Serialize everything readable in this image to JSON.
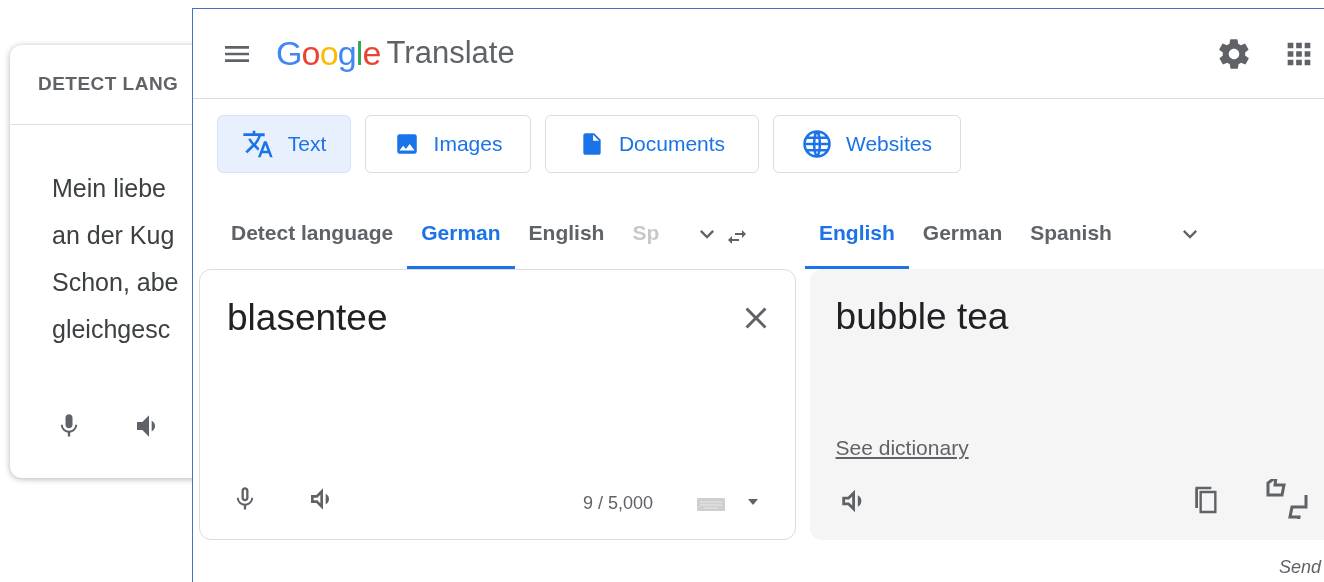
{
  "back_card": {
    "header": "DETECT LANG",
    "lines": [
      "Mein liebe",
      "an der Kug",
      "Schon, abe",
      "gleichgesc"
    ]
  },
  "app": {
    "logo": "Google",
    "product": "Translate",
    "modes": [
      {
        "kind": "text",
        "label": "Text",
        "selected": true
      },
      {
        "kind": "images",
        "label": "Images",
        "selected": false
      },
      {
        "kind": "documents",
        "label": "Documents",
        "selected": false
      },
      {
        "kind": "websites",
        "label": "Websites",
        "selected": false
      }
    ],
    "source_languages": [
      {
        "label": "Detect language",
        "selected": false,
        "faded": false
      },
      {
        "label": "German",
        "selected": true,
        "faded": false
      },
      {
        "label": "English",
        "selected": false,
        "faded": false
      },
      {
        "label": "Sp",
        "selected": false,
        "faded": true
      }
    ],
    "target_languages": [
      {
        "label": "English",
        "selected": true
      },
      {
        "label": "German",
        "selected": false
      },
      {
        "label": "Spanish",
        "selected": false
      }
    ],
    "source": {
      "text": "blasentee",
      "counter": "9 / 5,000"
    },
    "target": {
      "text": "bubble tea",
      "link": "See dictionary"
    },
    "feedback": "Send"
  }
}
